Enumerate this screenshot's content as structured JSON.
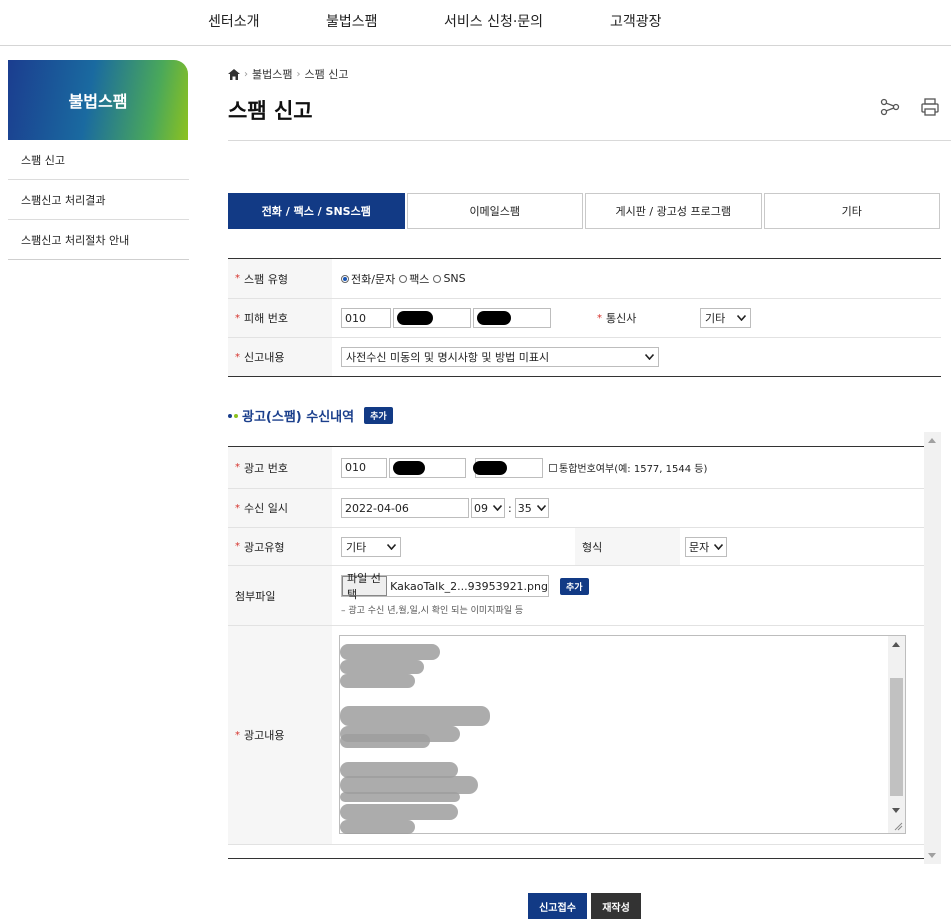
{
  "nav": {
    "items": [
      "센터소개",
      "불법스팸",
      "서비스 신청·문의",
      "고객광장"
    ]
  },
  "sidebar": {
    "title": "불법스팸",
    "items": [
      {
        "label": "스팸 신고"
      },
      {
        "label": "스팸신고 처리결과"
      },
      {
        "label": "스팸신고 처리절차 안내"
      }
    ]
  },
  "breadcrumb": {
    "items": [
      "불법스팸",
      "스팸 신고"
    ]
  },
  "page": {
    "title": "스팸 신고"
  },
  "tabs": [
    {
      "label": "전화 / 팩스 / SNS스팸",
      "active": true
    },
    {
      "label": "이메일스팸",
      "active": false
    },
    {
      "label": "게시판 / 광고성 프로그램",
      "active": false
    },
    {
      "label": "기타",
      "active": false
    }
  ],
  "report": {
    "spam_type": {
      "label": "스팸 유형",
      "options": [
        {
          "label": "전화/문자",
          "checked": true
        },
        {
          "label": "팩스",
          "checked": false
        },
        {
          "label": "SNS",
          "checked": false
        }
      ]
    },
    "victim_number": {
      "label": "피해 번호",
      "prefix": "010"
    },
    "carrier": {
      "label": "통신사",
      "value": "기타"
    },
    "content": {
      "label": "신고내용",
      "value": "사전수신 미동의 및 명시사항 및 방법 미표시"
    }
  },
  "received": {
    "title": "광고(스팸) 수신내역",
    "add_label": "추가",
    "ad_number": {
      "label": "광고 번호",
      "prefix": "010",
      "checkbox_label": "통합번호여부(예: 1577, 1544 등)"
    },
    "received_at": {
      "label": "수신 일시",
      "date": "2022-04-06",
      "hour": "09",
      "minute": "35",
      "sep": ":"
    },
    "ad_type": {
      "label": "광고유형",
      "value": "기타"
    },
    "format": {
      "label": "형식",
      "value": "문자"
    },
    "attachment": {
      "label": "첨부파일",
      "button_label": "파일 선택",
      "filename": "KakaoTalk_2...93953921.png",
      "add_label": "추가",
      "hint": "– 광고 수신 년,월,일,시 확인 되는 이미지파일 등"
    },
    "ad_content": {
      "label": "광고내용"
    }
  },
  "actions": {
    "submit": "신고접수",
    "reset": "재작성"
  },
  "colors": {
    "primary": "#123a85",
    "required": "#d6322c"
  }
}
